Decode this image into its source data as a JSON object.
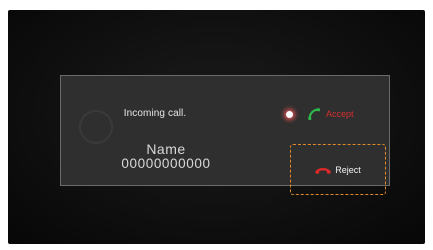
{
  "call": {
    "incoming_label": "Incoming call.",
    "caller_name": "Name",
    "caller_number": "00000000000"
  },
  "actions": {
    "accept_label": "Accept",
    "reject_label": "Reject"
  },
  "icons": {
    "accept": "phone-accept-icon",
    "reject": "phone-hangup-icon",
    "focus": "focus-dot-icon"
  },
  "colors": {
    "accept_icon": "#2fb84a",
    "accept_text": "#d42e2e",
    "reject_icon": "#e02a2a",
    "focus_outline": "#e08a2a"
  }
}
